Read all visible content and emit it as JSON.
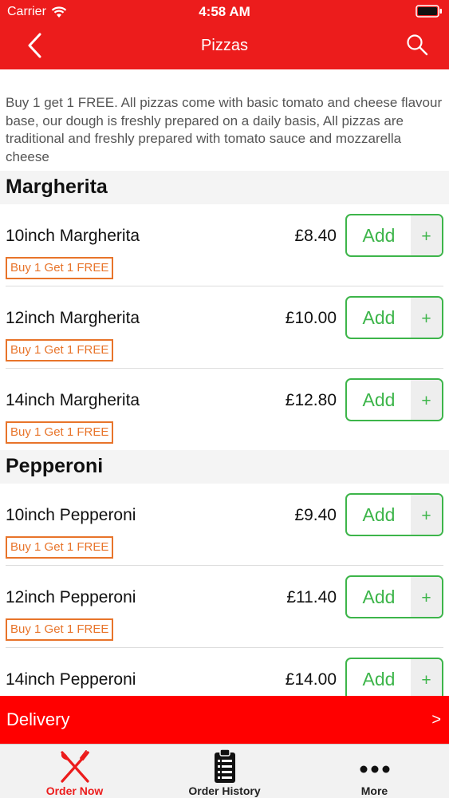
{
  "status": {
    "carrier": "Carrier",
    "time": "4:58 AM"
  },
  "nav": {
    "title": "Pizzas"
  },
  "description": "Buy 1 get 1 FREE. All pizzas come with basic tomato and cheese flavour base, our dough is freshly prepared on a daily basis, All pizzas are traditional and freshly prepared with tomato sauce and mozzarella cheese",
  "sections": [
    {
      "title": "Margherita",
      "items": [
        {
          "name": "10inch Margherita",
          "price": "£8.40",
          "offer": "Buy 1 Get 1 FREE",
          "add": "Add",
          "plus": "+"
        },
        {
          "name": "12inch Margherita",
          "price": "£10.00",
          "offer": "Buy 1 Get 1 FREE",
          "add": "Add",
          "plus": "+"
        },
        {
          "name": "14inch Margherita",
          "price": "£12.80",
          "offer": "Buy 1 Get 1 FREE",
          "add": "Add",
          "plus": "+"
        }
      ]
    },
    {
      "title": "Pepperoni",
      "items": [
        {
          "name": "10inch Pepperoni",
          "price": "£9.40",
          "offer": "Buy 1 Get 1 FREE",
          "add": "Add",
          "plus": "+"
        },
        {
          "name": "12inch Pepperoni",
          "price": "£11.40",
          "offer": "Buy 1 Get 1 FREE",
          "add": "Add",
          "plus": "+"
        },
        {
          "name": "14inch Pepperoni",
          "price": "£14.00",
          "add": "Add",
          "plus": "+"
        }
      ]
    }
  ],
  "delivery": {
    "label": "Delivery",
    "arrow": ">"
  },
  "tabs": [
    {
      "label": "Order Now",
      "icon": "fork-knife-icon",
      "active": true
    },
    {
      "label": "Order History",
      "icon": "clipboard-list-icon",
      "active": false
    },
    {
      "label": "More",
      "icon": "more-dots-icon",
      "active": false
    }
  ],
  "colors": {
    "brand_red": "#ec1c1c",
    "add_green": "#3db54a",
    "offer_orange": "#e8742a",
    "delivery_red": "#ff0000"
  }
}
